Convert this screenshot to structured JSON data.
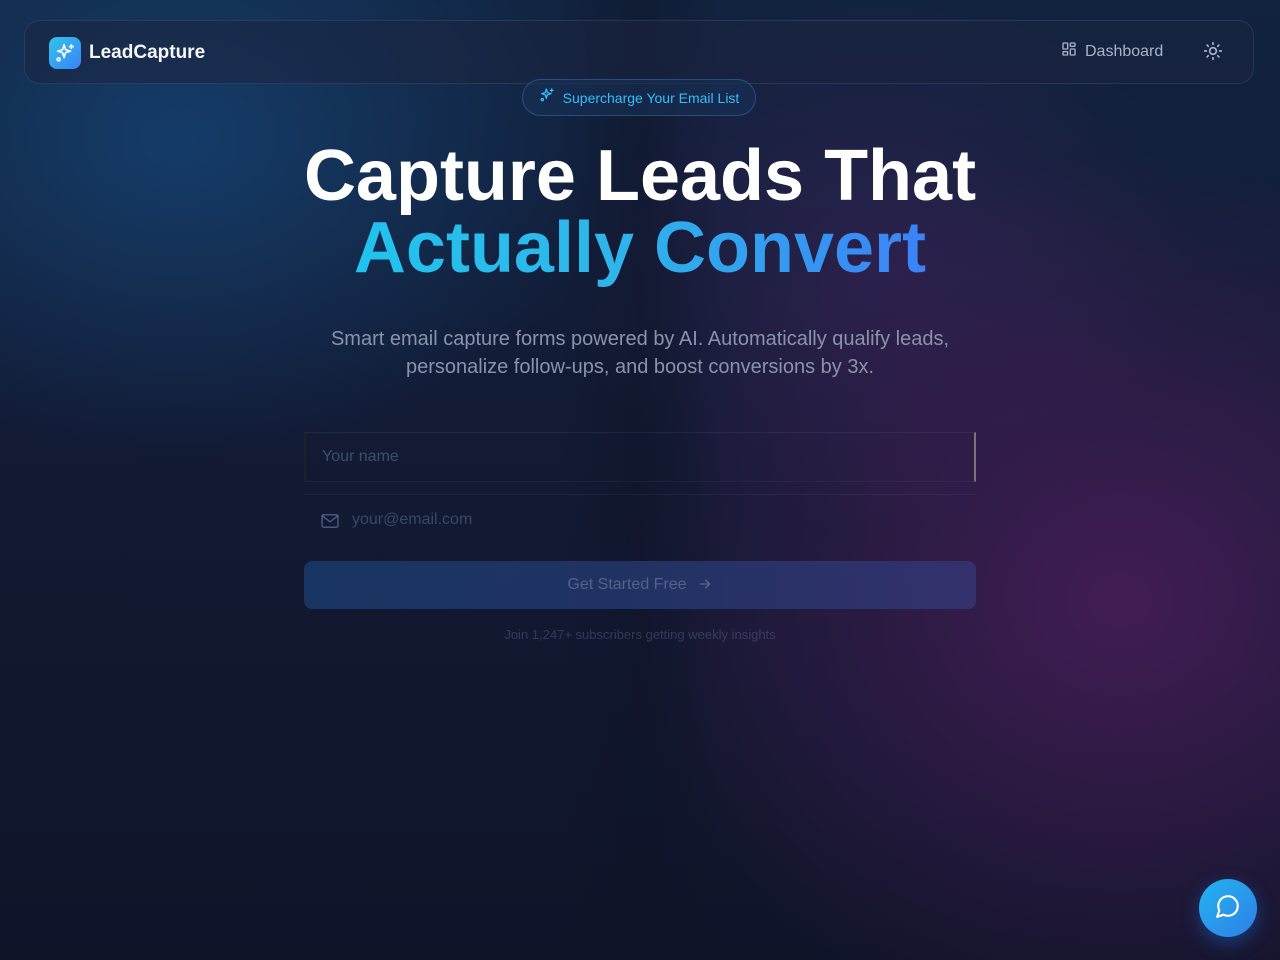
{
  "navbar": {
    "brand_name": "LeadCapture",
    "brand_icon": "sparkles-icon",
    "dashboard_label": "Dashboard",
    "dashboard_icon": "layout-dashboard-icon",
    "theme_toggle_icon": "sun-icon"
  },
  "hero": {
    "badge_label": "Supercharge Your Email List",
    "badge_icon": "sparkles-icon",
    "title_line_1": "Capture Leads That",
    "title_line_2": "Actually Convert",
    "subtitle": "Smart email capture forms powered by AI. Automatically qualify leads, personalize follow-ups, and boost conversions by 3x."
  },
  "form": {
    "name_placeholder": "Your name",
    "name_value": "",
    "email_placeholder": "your@email.com",
    "email_value": "",
    "email_icon": "mail-icon",
    "cta_label": "Get Started Free",
    "cta_icon": "arrow-right-icon",
    "social_proof": "Join 1,247+ subscribers getting weekly insights"
  },
  "chat": {
    "icon": "message-circle-icon"
  },
  "colors": {
    "accent_cyan": "#22c3ee",
    "accent_blue": "#3b82f6",
    "background": "#0e1326",
    "muted_text": "#8a93ab"
  }
}
